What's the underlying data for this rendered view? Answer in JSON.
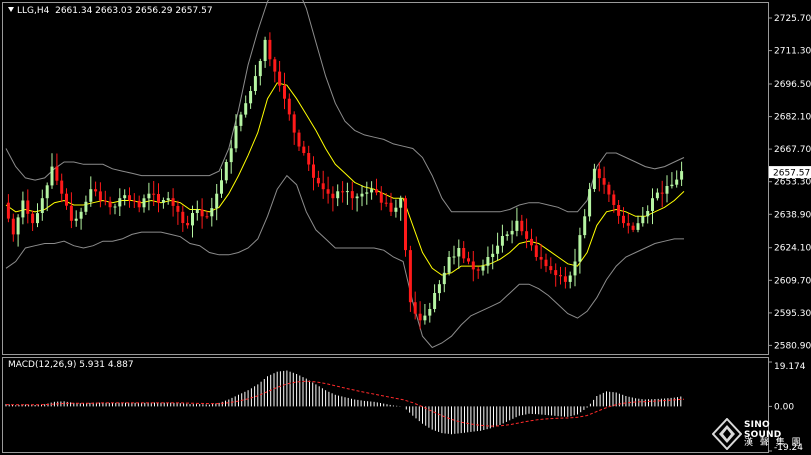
{
  "header": {
    "symbol": "LLG,H4",
    "ohlc": "2661.34 2663.03 2656.29 2657.57"
  },
  "indicator": {
    "label": "MACD(12,26,9) 5.931 4.887"
  },
  "current_price": "2657.57",
  "watermark": {
    "brand": "SINO SOUND",
    "sub": "漢 聲 集 團"
  },
  "colors": {
    "background": "#000000",
    "bull_candle": "#b6f5a3",
    "bear_candle": "#ff1a1a",
    "moving_average": "#ffff00",
    "bollinger_bands": "#8c8c8c",
    "macd_histogram": "#ffffff",
    "signal_line": "#ff2a2a",
    "price_tag": "#ffffff"
  },
  "chart_data": [
    {
      "type": "candlestick",
      "price_axis_ticks": [
        "2725.70",
        "2711.30",
        "2696.50",
        "2682.10",
        "2667.70",
        "2653.30",
        "2638.90",
        "2624.10",
        "2609.70",
        "2595.30",
        "2580.90"
      ],
      "ylim": [
        2578,
        2731
      ],
      "series": [
        {
          "name": "",
          "kind": "close",
          "values": [
            2644,
            2630,
            2645,
            2635,
            2646,
            2660,
            2648,
            2636,
            2640,
            2650,
            2645,
            2642,
            2646,
            2645,
            2642,
            2648,
            2644,
            2646,
            2640,
            2634,
            2641,
            2638,
            2648,
            2662,
            2678,
            2688,
            2700,
            2716,
            2702,
            2690,
            2675,
            2666,
            2655,
            2650,
            2646,
            2649,
            2646,
            2648,
            2650,
            2644,
            2640,
            2646,
            2600,
            2592,
            2597,
            2608,
            2620,
            2624,
            2618,
            2614,
            2620,
            2625,
            2630,
            2636,
            2628,
            2620,
            2616,
            2612,
            2609,
            2618,
            2638,
            2659,
            2652,
            2643,
            2635,
            2632,
            2638,
            2646,
            2648,
            2652,
            2658
          ]
        },
        {
          "name": "",
          "kind": "moving_average",
          "values": [
            2643,
            2640,
            2641,
            2640,
            2641,
            2644,
            2645,
            2643,
            2643,
            2644,
            2645,
            2644,
            2645,
            2645,
            2644,
            2645,
            2644,
            2645,
            2644,
            2641,
            2641,
            2640,
            2642,
            2648,
            2656,
            2665,
            2675,
            2690,
            2697,
            2696,
            2690,
            2683,
            2676,
            2668,
            2661,
            2657,
            2653,
            2651,
            2650,
            2648,
            2646,
            2646,
            2634,
            2622,
            2615,
            2612,
            2613,
            2616,
            2616,
            2616,
            2617,
            2619,
            2622,
            2626,
            2627,
            2626,
            2623,
            2620,
            2617,
            2616,
            2622,
            2634,
            2640,
            2641,
            2640,
            2638,
            2638,
            2640,
            2642,
            2645,
            2649
          ]
        },
        {
          "name": "",
          "kind": "bollinger_upper",
          "values": [
            2668,
            2660,
            2655,
            2654,
            2655,
            2659,
            2662,
            2662,
            2661,
            2661,
            2661,
            2659,
            2658,
            2657,
            2656,
            2656,
            2656,
            2656,
            2656,
            2656,
            2656,
            2656,
            2658,
            2668,
            2685,
            2705,
            2720,
            2733,
            2740,
            2744,
            2740,
            2730,
            2715,
            2700,
            2688,
            2680,
            2676,
            2674,
            2673,
            2672,
            2670,
            2669,
            2668,
            2664,
            2656,
            2646,
            2640,
            2640,
            2640,
            2640,
            2640,
            2640,
            2641,
            2643,
            2644,
            2644,
            2643,
            2642,
            2640,
            2640,
            2645,
            2660,
            2666,
            2666,
            2664,
            2662,
            2660,
            2659,
            2660,
            2662,
            2664
          ]
        },
        {
          "name": "",
          "kind": "bollinger_lower",
          "values": [
            2615,
            2618,
            2624,
            2625,
            2626,
            2626,
            2627,
            2625,
            2624,
            2625,
            2627,
            2627,
            2628,
            2630,
            2631,
            2631,
            2631,
            2630,
            2629,
            2626,
            2625,
            2622,
            2621,
            2621,
            2622,
            2624,
            2628,
            2638,
            2650,
            2656,
            2652,
            2640,
            2632,
            2628,
            2624,
            2624,
            2624,
            2624,
            2624,
            2623,
            2620,
            2618,
            2600,
            2585,
            2580,
            2582,
            2585,
            2590,
            2594,
            2596,
            2598,
            2600,
            2604,
            2608,
            2608,
            2606,
            2603,
            2599,
            2595,
            2593,
            2596,
            2602,
            2610,
            2616,
            2620,
            2622,
            2624,
            2626,
            2627,
            2628,
            2628
          ]
        }
      ]
    },
    {
      "type": "bar",
      "indicator": "MACD",
      "params": [
        12,
        26,
        9
      ],
      "ylim": [
        -19.24,
        19.174
      ],
      "tick_labels": [
        "19.174",
        "0.00",
        "-19.24"
      ],
      "series": [
        {
          "name": "",
          "kind": "histogram",
          "values": [
            1.0,
            0.5,
            0.8,
            0.6,
            0.9,
            2.0,
            2.2,
            1.5,
            1.3,
            1.6,
            1.6,
            1.5,
            1.6,
            1.6,
            1.5,
            1.7,
            1.6,
            1.6,
            1.4,
            1.0,
            1.0,
            0.8,
            1.5,
            3.0,
            5.0,
            7.0,
            9.5,
            13.0,
            15.0,
            15.5,
            14.0,
            12.0,
            9.5,
            7.0,
            5.0,
            4.0,
            3.0,
            2.4,
            2.0,
            1.2,
            0.4,
            0.0,
            -4.0,
            -7.5,
            -10.0,
            -11.5,
            -12.0,
            -11.5,
            -11.0,
            -10.5,
            -9.5,
            -8.0,
            -6.0,
            -4.0,
            -3.2,
            -3.4,
            -3.8,
            -4.2,
            -4.5,
            -3.5,
            -0.5,
            4.5,
            6.5,
            6.0,
            4.5,
            3.5,
            3.0,
            3.2,
            3.4,
            3.8,
            4.5
          ]
        },
        {
          "name": "",
          "kind": "signal",
          "values": [
            0.8,
            0.7,
            0.7,
            0.7,
            0.8,
            1.0,
            1.3,
            1.4,
            1.4,
            1.4,
            1.5,
            1.5,
            1.5,
            1.5,
            1.5,
            1.5,
            1.5,
            1.5,
            1.5,
            1.4,
            1.3,
            1.2,
            1.2,
            1.6,
            2.3,
            3.3,
            4.6,
            6.4,
            8.2,
            9.7,
            10.6,
            10.9,
            10.6,
            9.9,
            8.9,
            7.9,
            7.0,
            6.1,
            5.3,
            4.5,
            3.7,
            2.9,
            1.6,
            -0.1,
            -2.1,
            -4.0,
            -5.6,
            -6.8,
            -7.6,
            -8.2,
            -8.5,
            -8.4,
            -7.9,
            -7.1,
            -6.3,
            -5.7,
            -5.3,
            -5.1,
            -5.0,
            -4.7,
            -3.9,
            -2.2,
            -0.5,
            0.8,
            1.5,
            1.9,
            2.1,
            2.3,
            2.5,
            2.8,
            3.1
          ]
        }
      ]
    }
  ]
}
